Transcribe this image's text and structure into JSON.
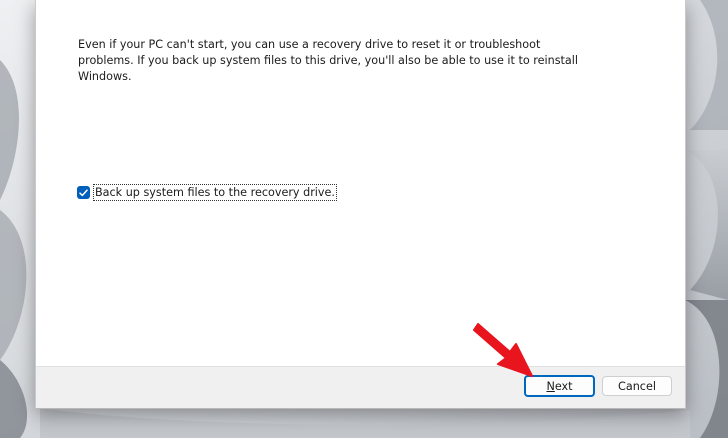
{
  "dialog": {
    "description": "Even if your PC can't start, you can use a recovery drive to reset it or troubleshoot problems. If you back up system files to this drive, you'll also be able to use it to reinstall Windows.",
    "checkbox": {
      "label": "Back up system files to the recovery drive.",
      "checked": true
    },
    "buttons": {
      "next_label": "Next",
      "cancel_label": "Cancel"
    }
  },
  "colors": {
    "accent": "#005fb8",
    "annotation_arrow": "#e8141e",
    "footer_bg": "#f0f0f0"
  },
  "icons": {
    "checkbox_mark": "checkmark-icon",
    "annotation": "arrow-pointer-icon"
  }
}
